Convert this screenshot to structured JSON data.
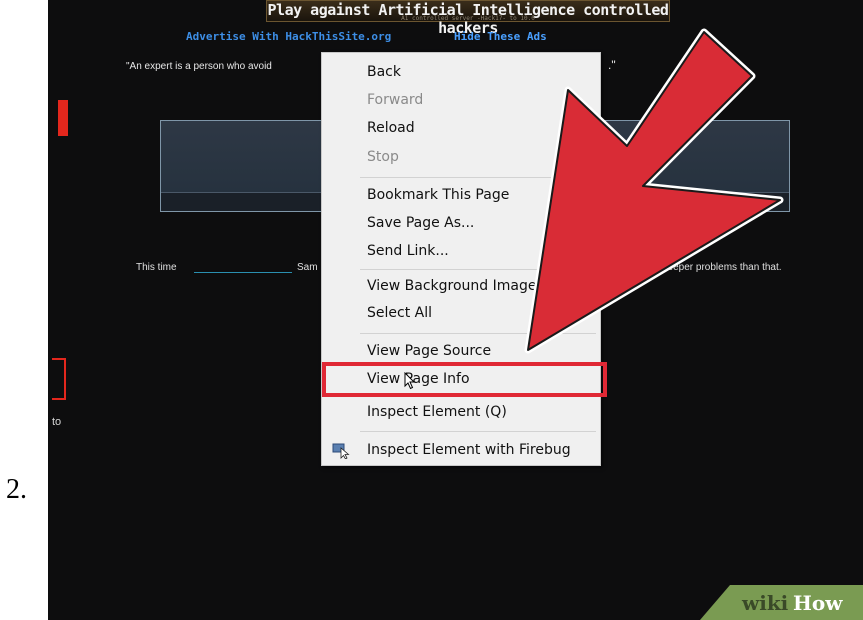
{
  "step": {
    "number": "2."
  },
  "banner": {
    "title": "Play against Artificial Intelligence controlled hackers",
    "subtext": "A1 controlled server  -Hack17- to 10.0"
  },
  "ads": {
    "advertise_label": "Advertise With HackThisSite.org",
    "hide_label": "Hide These Ads"
  },
  "page": {
    "quote_start": "\"An expert is a person who avoid",
    "quote_end": ".\"",
    "side_text": "to",
    "line_left": "This time",
    "line_word": "Sam",
    "line_right": "deeper problems than that."
  },
  "context_menu": {
    "items": [
      {
        "label": "Back",
        "disabled": false
      },
      {
        "label": "Forward",
        "disabled": true
      },
      {
        "label": "Reload",
        "disabled": false
      },
      {
        "label": "Stop",
        "disabled": true
      },
      {
        "label": "Bookmark This Page",
        "disabled": false
      },
      {
        "label": "Save Page As...",
        "disabled": false
      },
      {
        "label": "Send Link...",
        "disabled": false
      },
      {
        "label": "View Background Image",
        "disabled": false
      },
      {
        "label": "Select All",
        "disabled": false
      },
      {
        "label": "View Page Source",
        "disabled": false
      },
      {
        "label": "View Page Info",
        "disabled": false,
        "highlighted": true
      },
      {
        "label": "Inspect Element (Q)",
        "disabled": false
      },
      {
        "label": "Inspect Element with Firebug",
        "disabled": false,
        "icon": "firebug-icon"
      }
    ]
  },
  "annotation": {
    "arrow_icon": "red-arrow-icon",
    "arrow_color": "#e02835",
    "highlight_color": "#e02835"
  },
  "watermark": {
    "wiki": "wiki",
    "how": "How"
  }
}
